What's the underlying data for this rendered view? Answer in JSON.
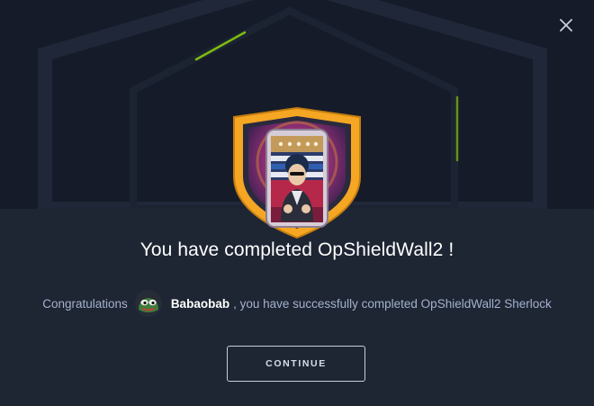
{
  "dialog": {
    "title": "You have completed OpShieldWall2 !",
    "message_prefix": "Congratulations",
    "username": "Babaobab",
    "message_suffix": ", you have successfully completed OpShieldWall2 Sherlock",
    "continue_label": "CONTINUE"
  },
  "icons": {
    "close": "close-icon",
    "badge": "sherlock-badge-icon",
    "avatar": "user-avatar-frog-icon"
  },
  "colors": {
    "background": "#1c2331",
    "badge_gold": "#f5a623",
    "accent_green": "#9fef00",
    "title": "#ffffff",
    "message": "#a4b1cd"
  }
}
